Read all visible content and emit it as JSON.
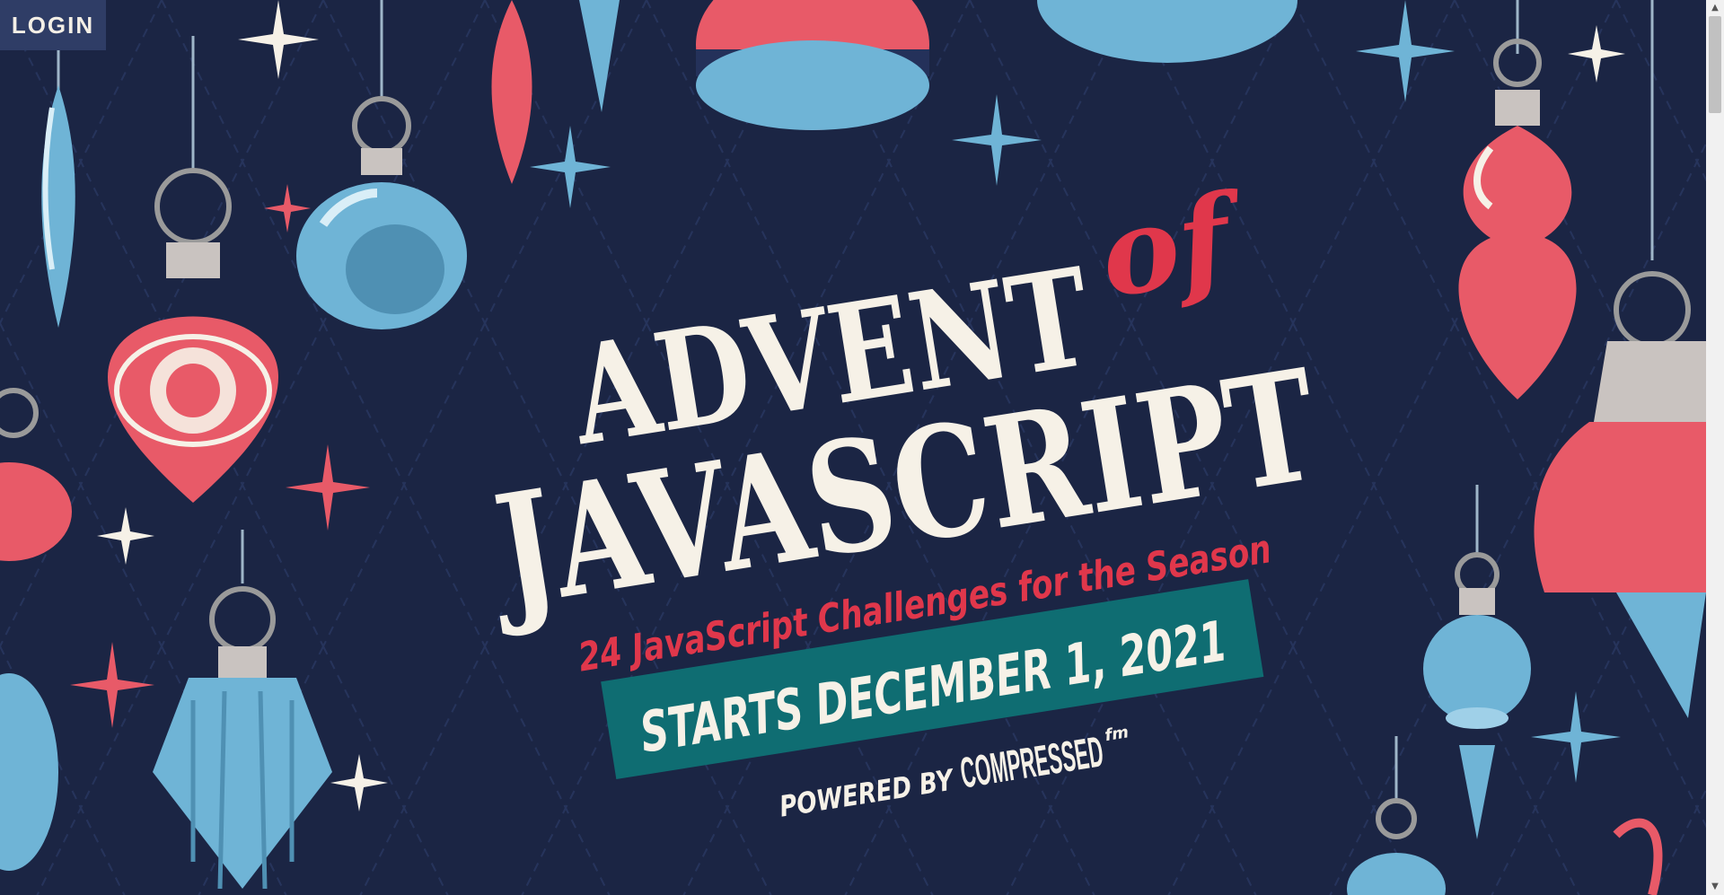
{
  "nav": {
    "login_label": "LOGIN"
  },
  "hero": {
    "title_line1": "ADVENT",
    "title_of": "of",
    "title_line2": "JAVASCRIPT",
    "tagline": "24 JavaScript Challenges for the Season",
    "start_date": "STARTS DECEMBER 1, 2021",
    "powered_by": "POWERED BY",
    "sponsor": "COMPRESSED",
    "sponsor_suffix": "fm"
  },
  "theme": {
    "background": "#1b2544",
    "cream": "#f6f1e7",
    "red": "#e0374b",
    "blue": "#6fb4d6",
    "teal": "#0f6d72"
  },
  "icons": [
    "ornament-icon",
    "sparkle-star-icon",
    "scroll-arrow-up-icon",
    "scroll-arrow-down-icon"
  ]
}
